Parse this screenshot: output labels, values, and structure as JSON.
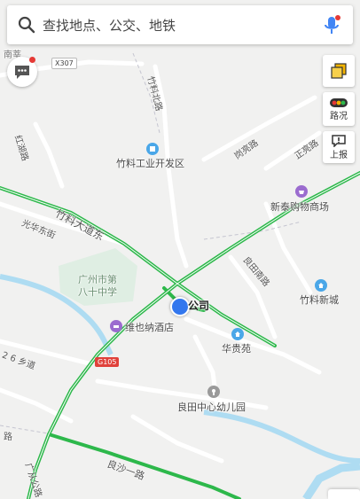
{
  "search": {
    "placeholder": "查找地点、公交、地铁"
  },
  "side_buttons": {
    "traffic_label": "路况",
    "report_label": "上报"
  },
  "place_labels": {
    "zhuliao_industrial": "竹料工业开发区",
    "xintai_mall": "新泰购物商场",
    "gz_school_line1": "广州市第",
    "gz_school_line2": "八十中学",
    "vienna_hotel": "维也纳酒店",
    "huagui_yuan": "华贵苑",
    "liangtian_kindergarten": "良田中心幼儿园",
    "zhuliao_xincheng": "竹料新城",
    "company": "公司",
    "nancun_partial": "南莘"
  },
  "road_labels": {
    "zhuliao_dadao_east": "竹料大道东",
    "guanghua_east": "光华东街",
    "honghu_road": "红湖路",
    "zhujiang_road": "竹料北路",
    "gangjing_road": "岗亮路",
    "zhengliang_road": "正亮路",
    "liangtian_south": "良田南路",
    "xiang_26": "2 6 乡道",
    "liangsha_road": "良沙一路",
    "guangcong_partial": "广从公路",
    "left_road_partial": "路"
  },
  "shields": {
    "x307": "X307",
    "g105": "G105"
  },
  "colors": {
    "traffic_green": "#2db84b",
    "water": "#aedcf2",
    "location_blue": "#3377ee",
    "search_mic_blue": "#4285f4",
    "poi_blue": "#4aa7e8",
    "poi_purple": "#9b6ccf"
  }
}
